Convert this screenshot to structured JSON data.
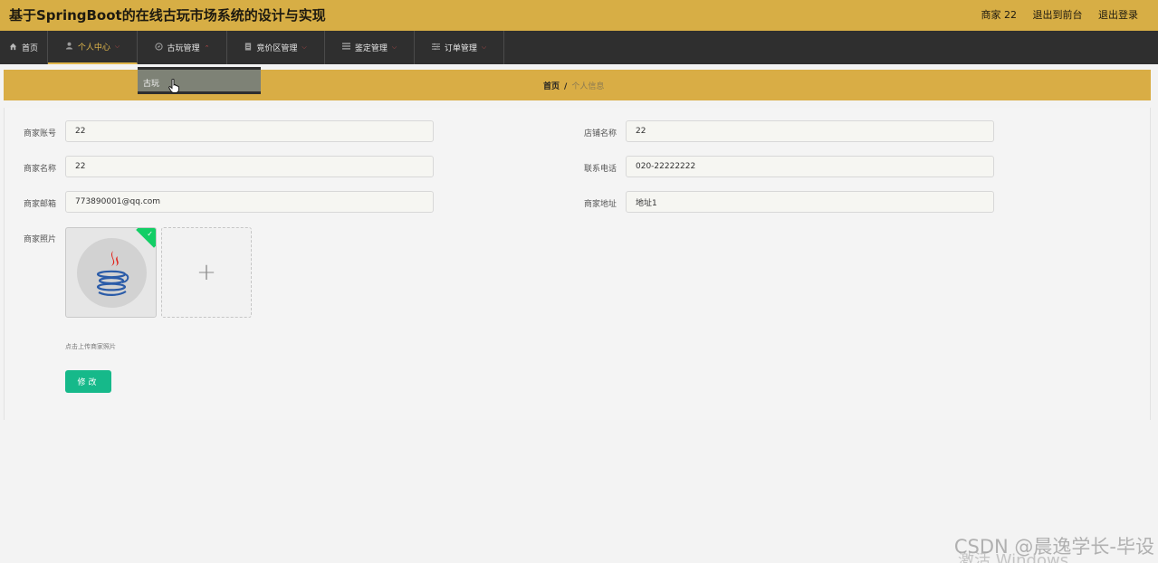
{
  "header": {
    "title": "基于SpringBoot的在线古玩市场系统的设计与实现",
    "user": "商家 22",
    "to_front": "退出到前台",
    "logout": "退出登录"
  },
  "nav": [
    {
      "label": "首页",
      "icon": "home-icon"
    },
    {
      "label": "个人中心",
      "icon": "user-icon"
    },
    {
      "label": "古玩管理",
      "icon": "compass-icon"
    },
    {
      "label": "竞价区管理",
      "icon": "document-icon"
    },
    {
      "label": "鉴定管理",
      "icon": "list-icon"
    },
    {
      "label": "订单管理",
      "icon": "sliders-icon"
    }
  ],
  "dropdown": {
    "items": [
      {
        "label": "古玩"
      }
    ]
  },
  "breadcrumb": {
    "home": "首页",
    "separator": "/",
    "current": "个人信息"
  },
  "form": {
    "merchant_account": {
      "label": "商家账号",
      "value": "22"
    },
    "shop_name": {
      "label": "店铺名称",
      "value": "22"
    },
    "merchant_name": {
      "label": "商家名称",
      "value": "22"
    },
    "phone": {
      "label": "联系电话",
      "value": "020-22222222"
    },
    "email": {
      "label": "商家邮箱",
      "value": "773890001@qq.com"
    },
    "address": {
      "label": "商家地址",
      "value": "地址1"
    },
    "photo": {
      "label": "商家照片",
      "tip": "点击上传商家照片",
      "uploaded": true
    },
    "submit_label": "修改"
  },
  "watermark": {
    "csdn": "CSDN @晨逸学长-毕设",
    "windows": "激活 Windows"
  },
  "colors": {
    "header": "#d7ae45",
    "nav": "#2f2f2f",
    "accent": "#e0b64b",
    "button": "#16b98a",
    "success": "#13ce66"
  }
}
